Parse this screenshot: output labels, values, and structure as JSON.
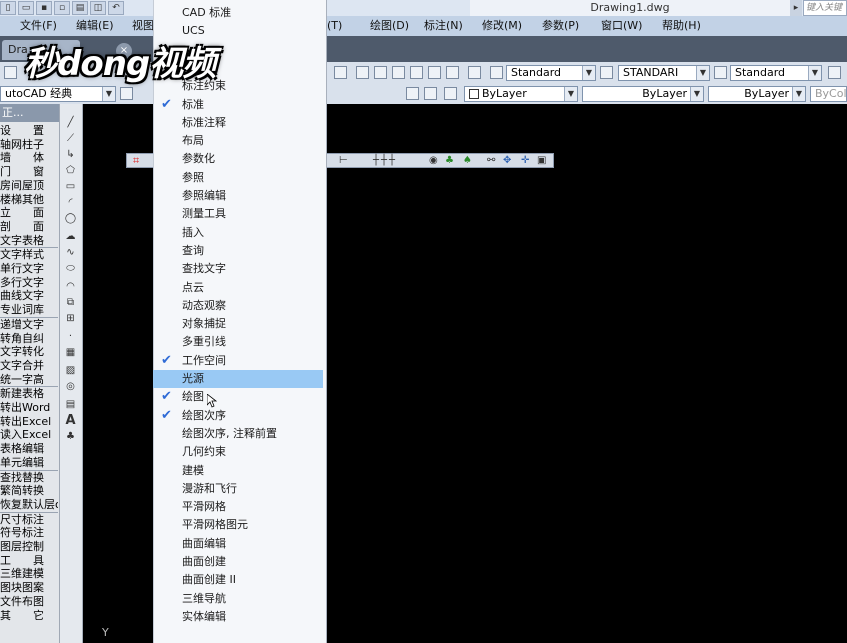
{
  "window": {
    "doc_title": "Drawing1.dwg",
    "search_placeholder": "键入关键"
  },
  "menubar": [
    {
      "label": "文件(F)"
    },
    {
      "label": "编辑(E)"
    },
    {
      "label": "视图"
    },
    {
      "label": "(T)"
    },
    {
      "label": "绘图(D)"
    },
    {
      "label": "标注(N)"
    },
    {
      "label": "修改(M)"
    },
    {
      "label": "参数(P)"
    },
    {
      "label": "窗口(W)"
    },
    {
      "label": "帮助(H)"
    }
  ],
  "tabs": {
    "doc_tab": "Dra"
  },
  "watermark": "秒dong视频",
  "toolbar1": {
    "text_style": "Standard",
    "dim_style": "STANDARI",
    "table_style": "Standard"
  },
  "toolbar2": {
    "workspace": "utoCAD 经典",
    "layer_color": "ByLayer",
    "linetype": "ByLayer",
    "lineweight": "ByLayer",
    "plot_style": "ByColo"
  },
  "palette": {
    "header": "正...",
    "items": [
      "设　　置",
      "轴网柱子",
      "墙　　体",
      "门　　窗",
      "房间屋顶",
      "楼梯其他",
      "立　　面",
      "剖　　面",
      "文字表格",
      "文字样式",
      "单行文字",
      "多行文字",
      "曲线文字",
      "专业词库",
      "递增文字",
      "转角自纠",
      "文字转化",
      "文字合并",
      "统一字高",
      "新建表格",
      "转出Word",
      "转出Excel",
      "读入Excel",
      "表格编辑",
      "单元编辑",
      "查找替换",
      "繁简转换",
      "恢复默认层o",
      "尺寸标注",
      "符号标注",
      "图层控制",
      "工　　具",
      "三维建模",
      "图块图案",
      "文件布图",
      "其　　它"
    ]
  },
  "ucs_label": "Y",
  "context_menu": {
    "items": [
      {
        "label": "CAD 标准",
        "checked": false,
        "highlighted": false
      },
      {
        "label": "UCS",
        "checked": false,
        "highlighted": false
      },
      {
        "label": "",
        "checked": false,
        "highlighted": false
      },
      {
        "label": "标注",
        "checked": false,
        "highlighted": false
      },
      {
        "label": "标注约束",
        "checked": false,
        "highlighted": false
      },
      {
        "label": "标准",
        "checked": true,
        "highlighted": false
      },
      {
        "label": "标准注释",
        "checked": false,
        "highlighted": false
      },
      {
        "label": "布局",
        "checked": false,
        "highlighted": false
      },
      {
        "label": "参数化",
        "checked": false,
        "highlighted": false
      },
      {
        "label": "参照",
        "checked": false,
        "highlighted": false
      },
      {
        "label": "参照编辑",
        "checked": false,
        "highlighted": false
      },
      {
        "label": "测量工具",
        "checked": false,
        "highlighted": false
      },
      {
        "label": "插入",
        "checked": false,
        "highlighted": false
      },
      {
        "label": "查询",
        "checked": false,
        "highlighted": false
      },
      {
        "label": "查找文字",
        "checked": false,
        "highlighted": false
      },
      {
        "label": "点云",
        "checked": false,
        "highlighted": false
      },
      {
        "label": "动态观察",
        "checked": false,
        "highlighted": false
      },
      {
        "label": "对象捕捉",
        "checked": false,
        "highlighted": false
      },
      {
        "label": "多重引线",
        "checked": false,
        "highlighted": false
      },
      {
        "label": "工作空间",
        "checked": true,
        "highlighted": false
      },
      {
        "label": "光源",
        "checked": false,
        "highlighted": true
      },
      {
        "label": "绘图",
        "checked": true,
        "highlighted": false
      },
      {
        "label": "绘图次序",
        "checked": true,
        "highlighted": false
      },
      {
        "label": "绘图次序, 注释前置",
        "checked": false,
        "highlighted": false
      },
      {
        "label": "几何约束",
        "checked": false,
        "highlighted": false
      },
      {
        "label": "建模",
        "checked": false,
        "highlighted": false
      },
      {
        "label": "漫游和飞行",
        "checked": false,
        "highlighted": false
      },
      {
        "label": "平滑网格",
        "checked": false,
        "highlighted": false
      },
      {
        "label": "平滑网格图元",
        "checked": false,
        "highlighted": false
      },
      {
        "label": "曲面编辑",
        "checked": false,
        "highlighted": false
      },
      {
        "label": "曲面创建",
        "checked": false,
        "highlighted": false
      },
      {
        "label": "曲面创建 II",
        "checked": false,
        "highlighted": false
      },
      {
        "label": "三维导航",
        "checked": false,
        "highlighted": false
      },
      {
        "label": "实体编辑",
        "checked": false,
        "highlighted": false
      }
    ]
  },
  "colors": {
    "highlight": "#99c9f4",
    "check": "#2f6bd6",
    "canvas": "#000000"
  }
}
